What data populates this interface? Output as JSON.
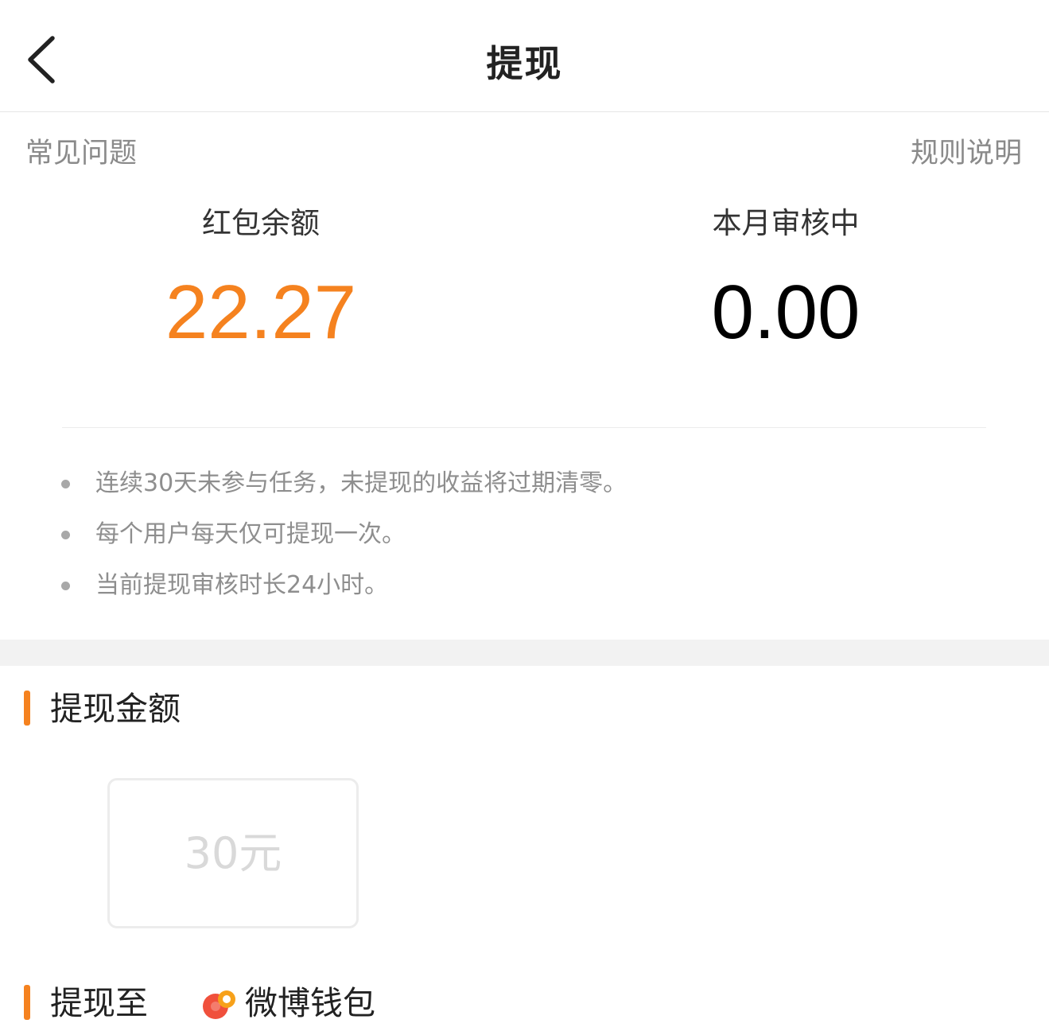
{
  "header": {
    "title": "提现",
    "back_icon": "chevron-left-icon"
  },
  "links": {
    "faq": "常见问题",
    "rules": "规则说明"
  },
  "balances": {
    "red_packet": {
      "label": "红包余额",
      "value": "22.27",
      "color": "#f5821f"
    },
    "pending": {
      "label": "本月审核中",
      "value": "0.00",
      "color": "#000000"
    }
  },
  "notes": [
    "连续30天未参与任务，未提现的收益将过期清零。",
    "每个用户每天仅可提现一次。",
    "当前提现审核时长24小时。"
  ],
  "withdraw_amount": {
    "heading": "提现金额",
    "options": [
      "30元"
    ]
  },
  "withdraw_to": {
    "heading": "提现至",
    "wallet_icon": "weibo-wallet-icon",
    "wallet_label": "微博钱包"
  },
  "colors": {
    "accent": "#f5821f",
    "muted_text": "#8e8e8e",
    "band": "#f2f2f2"
  }
}
